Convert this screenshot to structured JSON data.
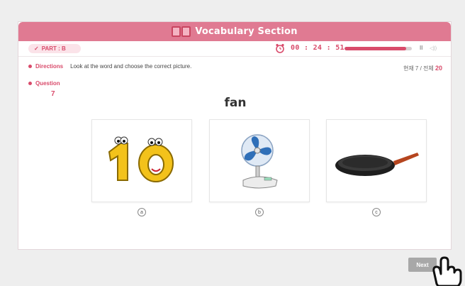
{
  "header": {
    "title": "Vocabulary Section"
  },
  "status": {
    "part_label": "PART : B",
    "timer": "00 : 24 : 51",
    "progress_fraction": 0.92,
    "pause_label": "II",
    "volume_label": "◁))"
  },
  "directions": {
    "label": "Directions",
    "text": "Look at the word and choose the correct picture.",
    "counter_prefix": "현재 7 / 전체",
    "counter_total": "20"
  },
  "question": {
    "label": "Question",
    "number": "7",
    "word": "fan"
  },
  "choices": [
    {
      "letter": "a",
      "image": "number-ten-cartoon"
    },
    {
      "letter": "b",
      "image": "desk-fan"
    },
    {
      "letter": "c",
      "image": "frying-pan"
    }
  ],
  "footer": {
    "next_label": "Next"
  },
  "colors": {
    "accent": "#e07a92",
    "accent_dark": "#d94b6b"
  }
}
